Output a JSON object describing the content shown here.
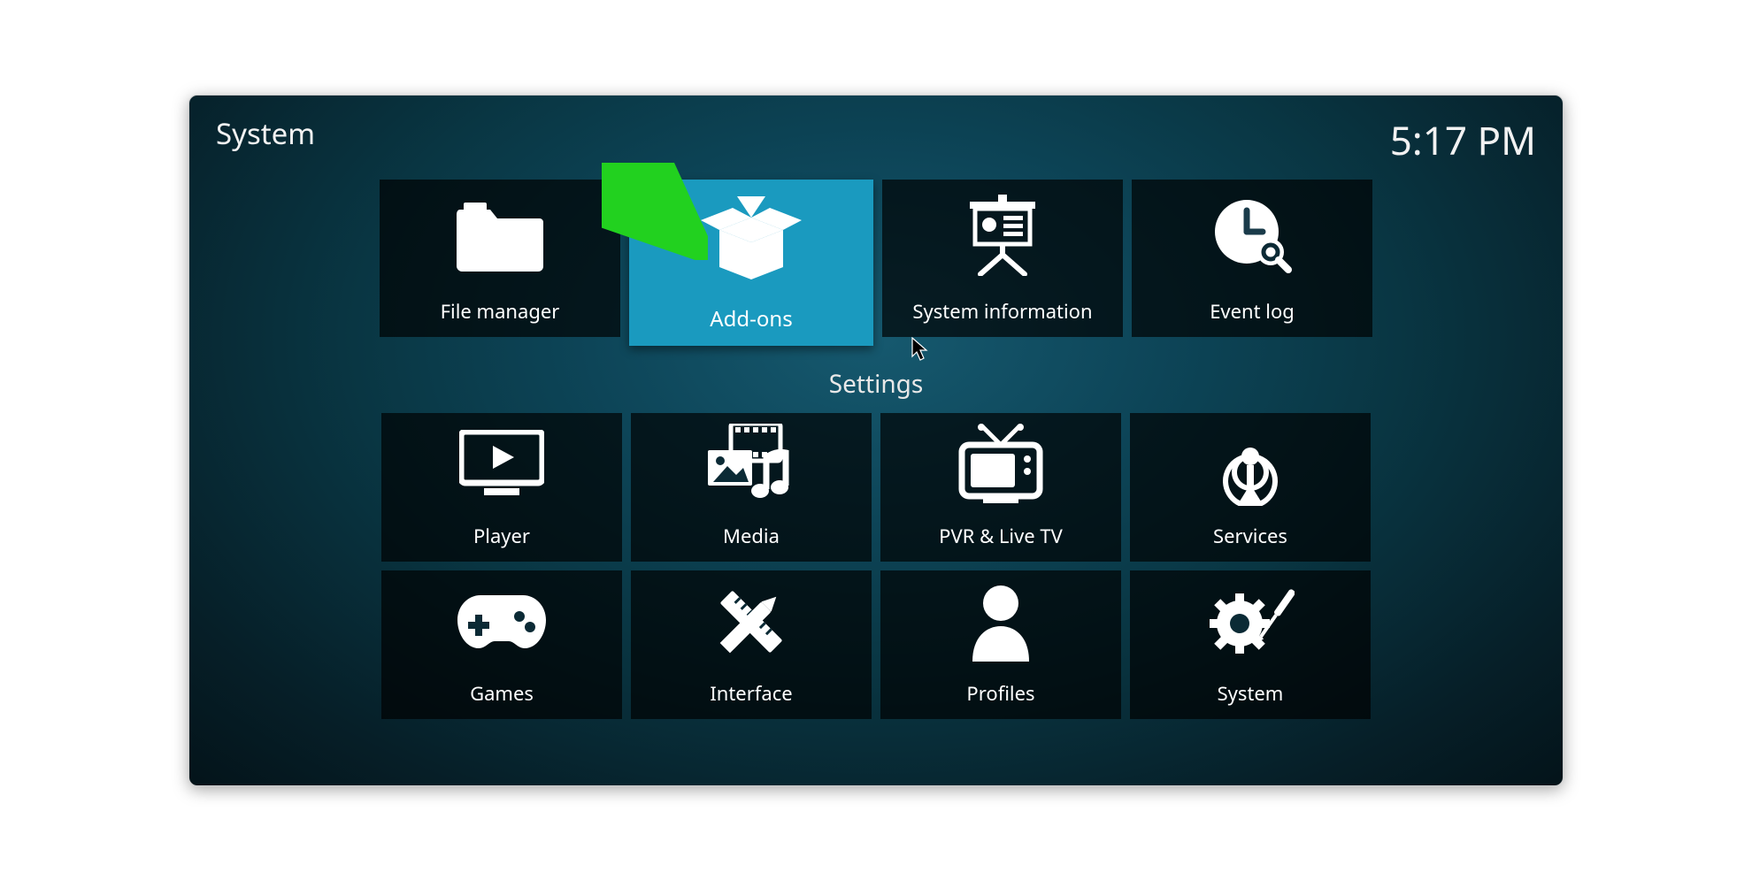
{
  "header": {
    "title": "System",
    "time": "5:17 PM"
  },
  "topRow": [
    {
      "label": "File manager",
      "selected": false
    },
    {
      "label": "Add-ons",
      "selected": true
    },
    {
      "label": "System information",
      "selected": false
    },
    {
      "label": "Event log",
      "selected": false
    }
  ],
  "section": {
    "title": "Settings"
  },
  "settingsRow1": [
    {
      "label": "Player"
    },
    {
      "label": "Media"
    },
    {
      "label": "PVR & Live TV"
    },
    {
      "label": "Services"
    }
  ],
  "settingsRow2": [
    {
      "label": "Games"
    },
    {
      "label": "Interface"
    },
    {
      "label": "Profiles"
    },
    {
      "label": "System"
    }
  ]
}
